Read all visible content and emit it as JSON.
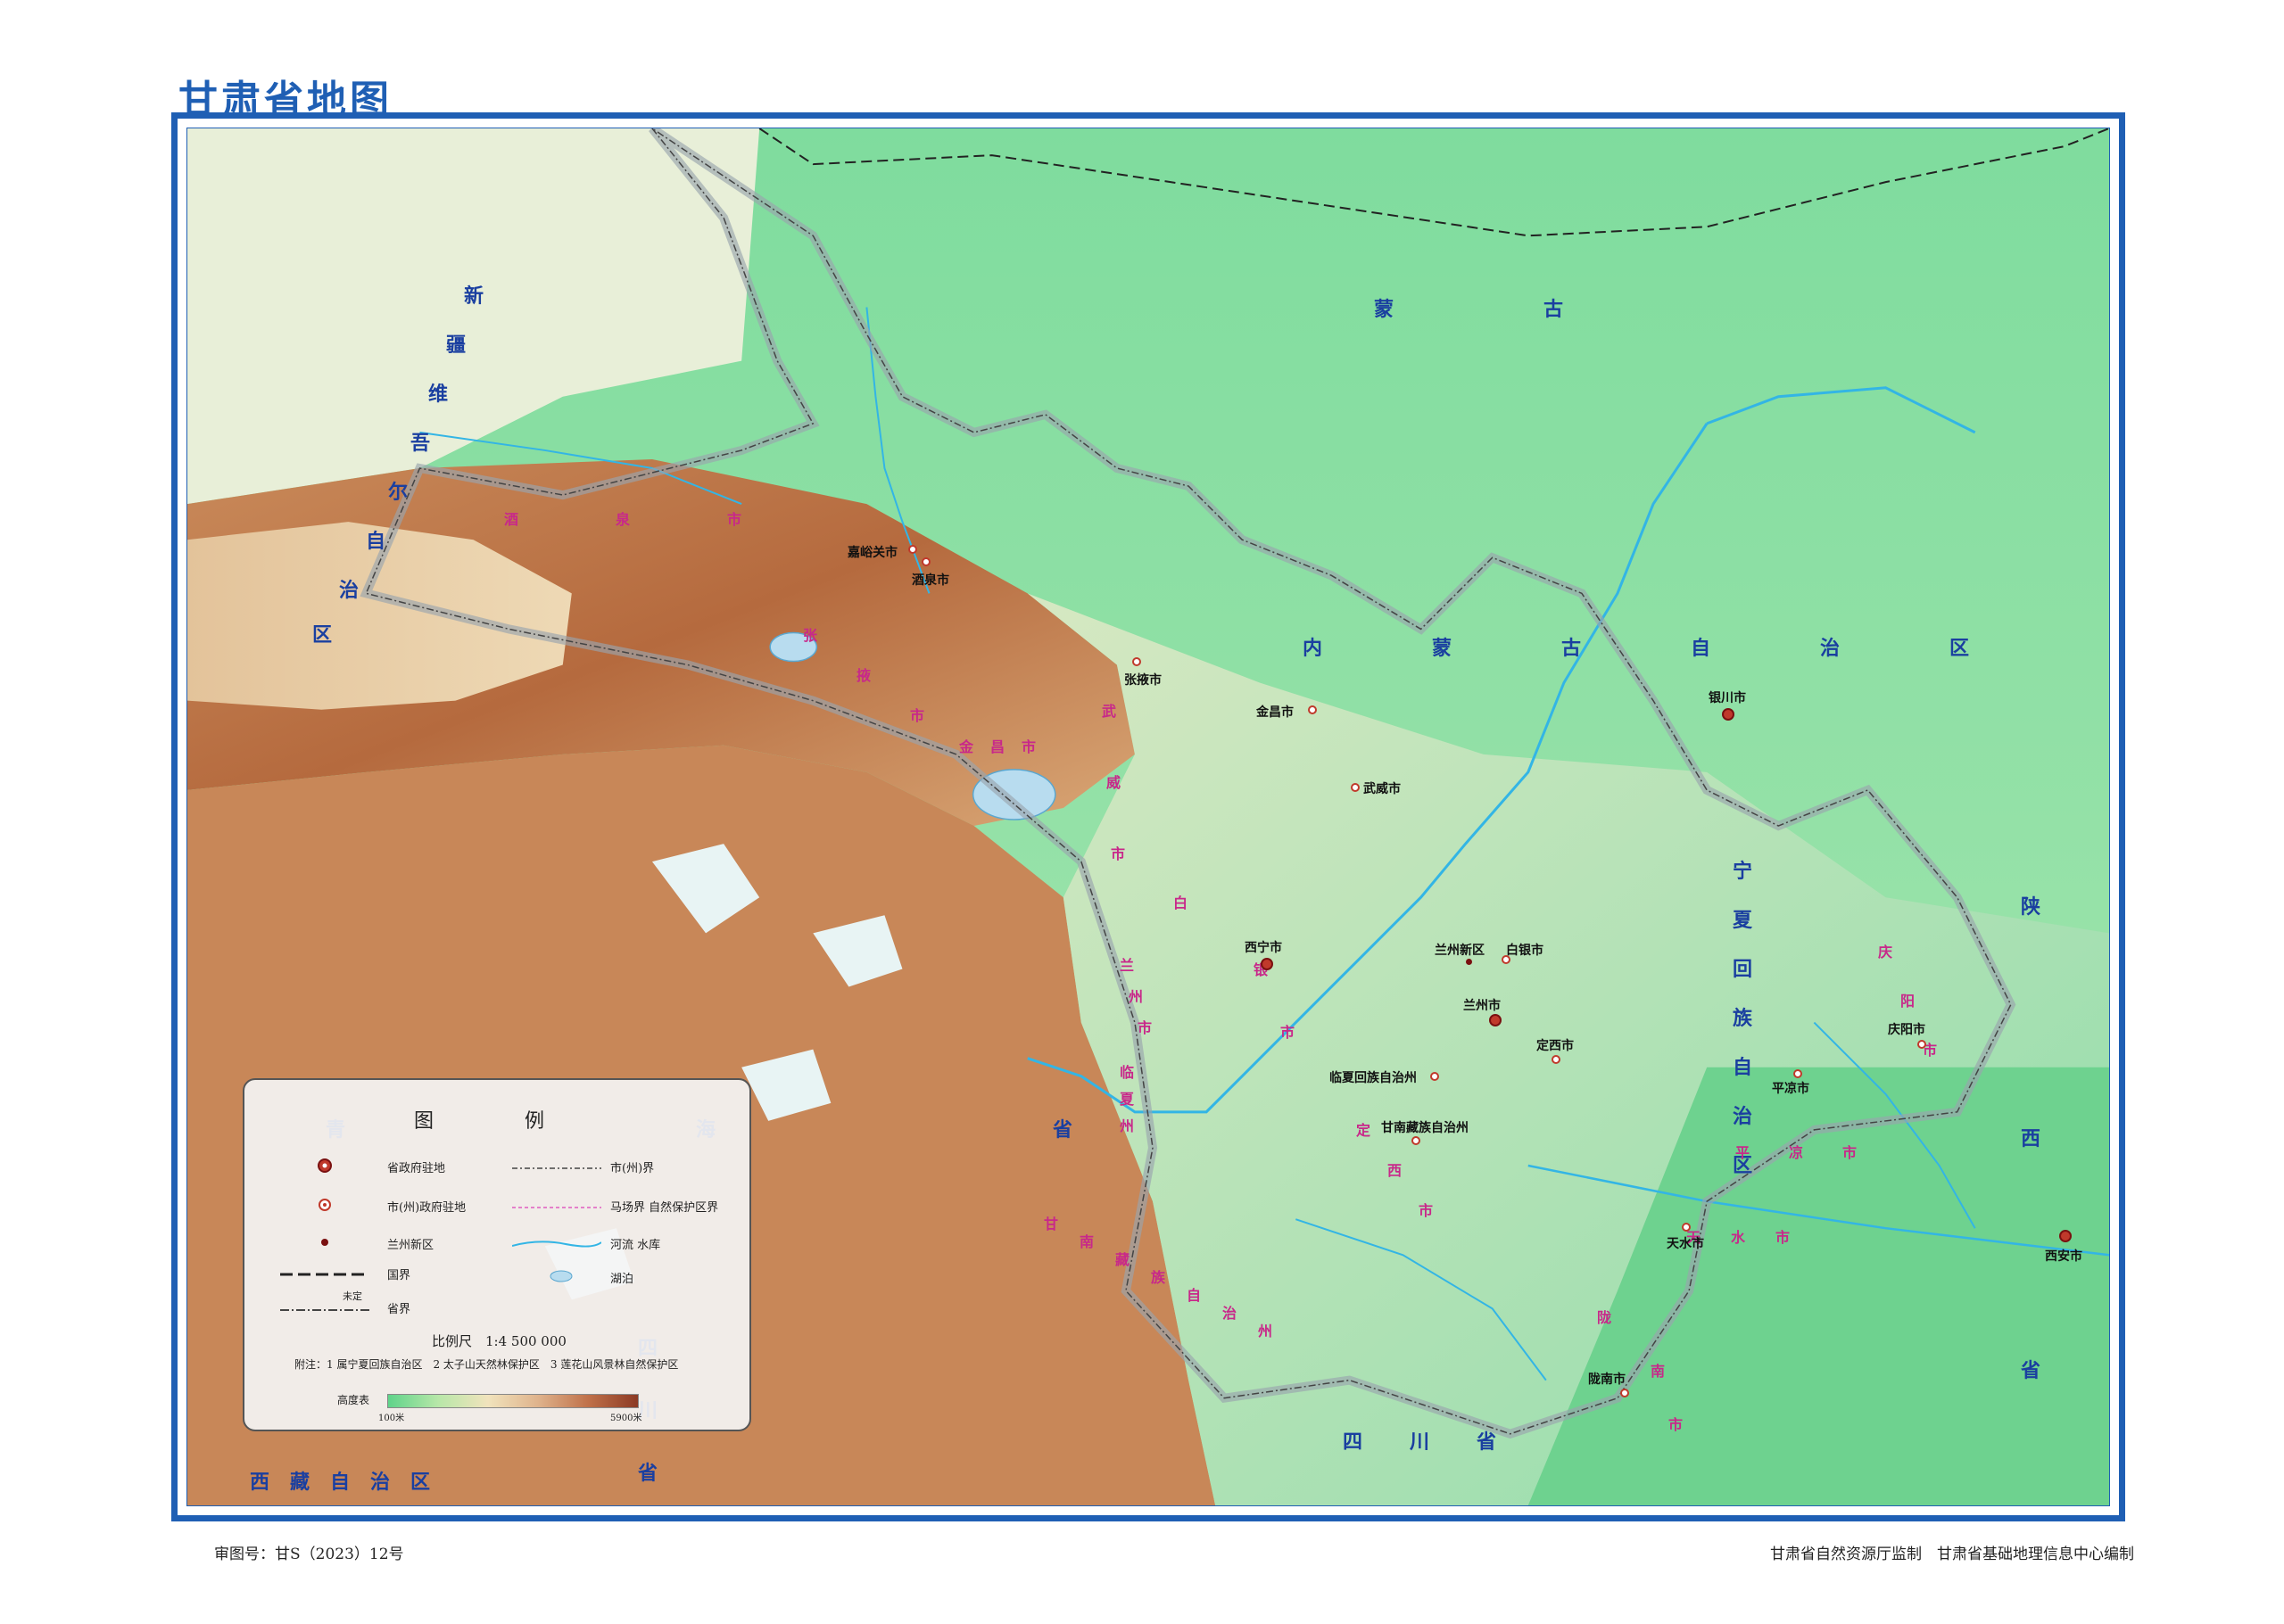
{
  "title": "甘肃省地图",
  "regions": {
    "xinjiang": [
      "新",
      "疆",
      "维",
      "吾",
      "尔",
      "自",
      "治",
      "区"
    ],
    "mongolia": [
      "蒙",
      "古"
    ],
    "neimenggu": [
      "内",
      "蒙",
      "古",
      "自",
      "治",
      "区"
    ],
    "ningxia": [
      "宁",
      "夏",
      "回",
      "族",
      "自",
      "治",
      "区"
    ],
    "qinghai": [
      "青",
      "海",
      "省"
    ],
    "xizang": [
      "西",
      "藏",
      "自",
      "治",
      "区"
    ],
    "sichuan_h": [
      "四",
      "川",
      "省"
    ],
    "sichuan_v": [
      "四",
      "川",
      "省"
    ],
    "shaanxi": [
      "陕",
      "西",
      "省"
    ]
  },
  "cities": {
    "jiayuguan": "嘉峪关市",
    "jiuquan": "酒泉市",
    "zhangye": "张掖市",
    "jinchang": "金昌市",
    "wuwei": "武威市",
    "yinchuan": "银川市",
    "xining": "西宁市",
    "lanzhou_new": "兰州新区",
    "baiyin": "白银市",
    "lanzhou": "兰州市",
    "dingxi": "定西市",
    "linxia": "临夏回族自治州",
    "gannan": "甘南藏族自治州",
    "pingliang": "平凉市",
    "qingyang": "庆阳市",
    "tianshui": "天水市",
    "longnan": "陇南市",
    "xian": "西安市"
  },
  "prefecture_labels": {
    "jiuquan": [
      "酒",
      "泉",
      "市"
    ],
    "zhangye": [
      "张",
      "掖",
      "市"
    ],
    "jinchang": [
      "金",
      "昌",
      "市"
    ],
    "wuwei": [
      "武",
      "威",
      "市"
    ],
    "baiyin": [
      "白",
      "银",
      "市"
    ],
    "lanzhou": [
      "兰",
      "州",
      "市"
    ],
    "linxia": [
      "临",
      "夏",
      "州"
    ],
    "dingxi": [
      "定",
      "西",
      "市"
    ],
    "gannan": [
      "甘",
      "南",
      "藏",
      "族",
      "自",
      "治",
      "州"
    ],
    "qingyang": [
      "庆",
      "阳",
      "市"
    ],
    "pingliang": [
      "平",
      "凉",
      "市"
    ],
    "tianshui": [
      "天",
      "水",
      "市"
    ],
    "longnan": [
      "陇",
      "南",
      "市"
    ]
  },
  "legend": {
    "title": "图　例",
    "items": {
      "prov_gov": "省政府驻地",
      "pref_gov": "市(州)政府驻地",
      "lanzhou_new": "兰州新区",
      "national_border": "国界",
      "undetermined": "未定",
      "provincial_border": "省界",
      "pref_border": "市(州)界",
      "reserve_border": "马场界 自然保护区界",
      "river": "河流 水库",
      "lake": "湖泊"
    },
    "scale": "比例尺　1:4 500 000",
    "note": "附注：1 属宁夏回族自治区　2 太子山天然林保护区　3 莲花山风景林自然保护区",
    "elevation_label": "高度表",
    "elevation_min": "100米",
    "elevation_max": "5900米"
  },
  "footer": {
    "left": "审图号：甘S（2023）12号",
    "right": "甘肃省自然资源厅监制　甘肃省基础地理信息中心编制"
  },
  "colors": {
    "frame": "#1f5fb4",
    "region_text": "#1a3fa0",
    "pref_text": "#c8288a"
  }
}
